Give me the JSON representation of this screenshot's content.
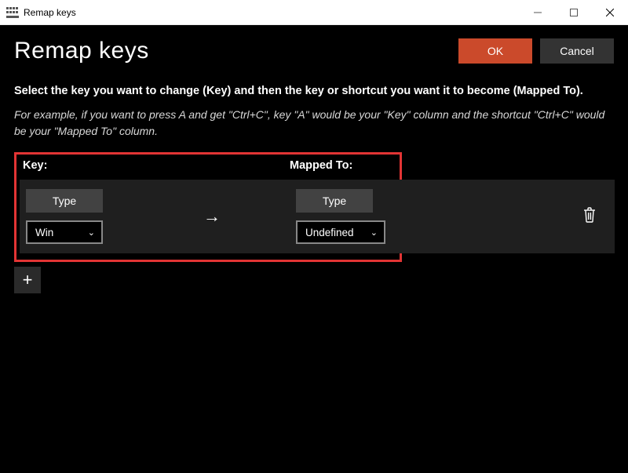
{
  "titlebar": {
    "title": "Remap keys"
  },
  "header": {
    "page_title": "Remap keys",
    "ok_label": "OK",
    "cancel_label": "Cancel"
  },
  "instructions": {
    "main": "Select the key you want to change (Key) and then the key or shortcut you want it to become (Mapped To).",
    "example": "For example, if you want to press A and get \"Ctrl+C\", key \"A\" would be your \"Key\" column and the shortcut \"Ctrl+C\" would be your \"Mapped To\" column."
  },
  "columns": {
    "key_label": "Key:",
    "mapped_label": "Mapped To:"
  },
  "row": {
    "key_type_label": "Type",
    "key_selected": "Win",
    "mapped_type_label": "Type",
    "mapped_selected": "Undefined"
  },
  "icons": {
    "arrow": "→",
    "chevron": "⌄",
    "plus": "+"
  }
}
